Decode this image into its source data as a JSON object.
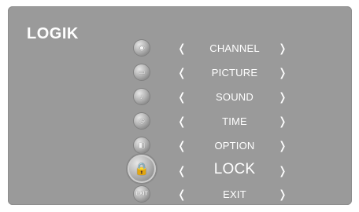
{
  "brand": {
    "logo_text": "LOGIK"
  },
  "menu": {
    "items": [
      {
        "label": "CHANNEL",
        "icon": "satellite-dish-icon",
        "glyph": "◉"
      },
      {
        "label": "PICTURE",
        "icon": "tv-screen-icon",
        "glyph": "▭"
      },
      {
        "label": "SOUND",
        "icon": "speaker-icon",
        "glyph": "♪"
      },
      {
        "label": "TIME",
        "icon": "clock-icon",
        "glyph": "◷"
      },
      {
        "label": "OPTION",
        "icon": "settings-icon",
        "glyph": "◧"
      },
      {
        "label": "LOCK",
        "icon": "lock-icon",
        "glyph": "🔒",
        "selected": true
      },
      {
        "label": "EXIT",
        "icon": "exit-icon",
        "glyph": "EXIT"
      }
    ],
    "left_arrow": "❬",
    "right_arrow": "❭"
  },
  "colors": {
    "background": "#9a9a9a",
    "text": "#ffffff"
  }
}
